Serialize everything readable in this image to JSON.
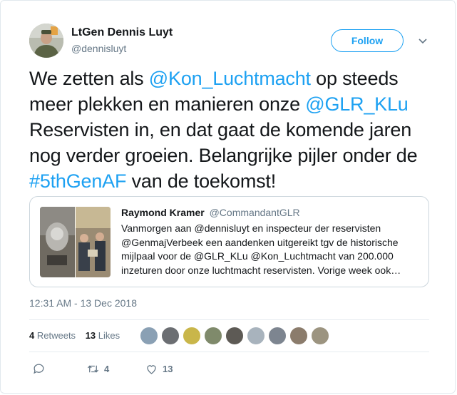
{
  "author": {
    "name": "LtGen Dennis Luyt",
    "handle": "@dennisluyt"
  },
  "follow_label": "Follow",
  "tweet": {
    "line1_pre": "We zetten als ",
    "mention1": "@Kon_Luchtmacht",
    "line1_post": " op steeds meer plekken en manieren onze ",
    "mention2": "@GLR_KLu",
    "mid_text": " Reservisten in, en dat gaat de komende jaren nog verder groeien. Belangrijke pijler onder de ",
    "hashtag": "#5thGenAF",
    "end_text": " van de toekomst!"
  },
  "quote": {
    "name": "Raymond Kramer",
    "handle": "@CommandantGLR",
    "text": "Vanmorgen aan @dennisluyt en inspecteur der reservisten @GenmajVerbeek een aandenken uitgereikt tgv de historische mijlpaal voor de @GLR_KLu @Kon_Luchtmacht van 200.000 inzeturen door onze luchtmacht reservisten. Vorige week ook…"
  },
  "timestamp": "12:31 AM - 13 Dec 2018",
  "stats": {
    "retweets_count": "4",
    "retweets_label": "Retweets",
    "likes_count": "13",
    "likes_label": "Likes"
  },
  "actions": {
    "retweet_count": "4",
    "like_count": "13"
  },
  "colors": {
    "accent": "#1da1f2",
    "secondary_text": "#657786",
    "border": "#e1e8ed"
  }
}
